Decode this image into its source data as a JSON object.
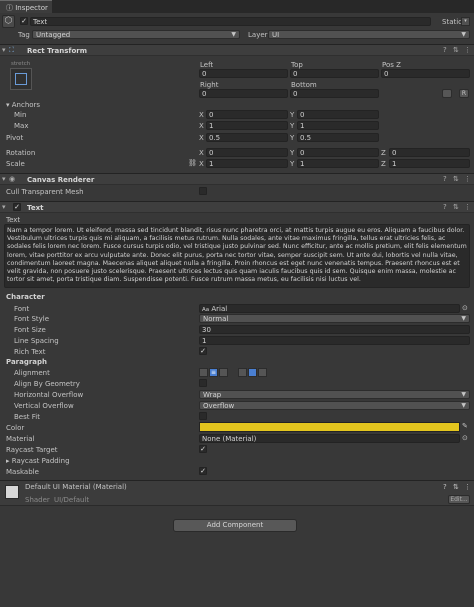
{
  "tab": {
    "label": "Inspector"
  },
  "object": {
    "name": "Text",
    "static_label": "Static",
    "tag_label": "Tag",
    "tag_value": "Untagged",
    "layer_label": "Layer",
    "layer_value": "UI"
  },
  "rect_transform": {
    "title": "Rect Transform",
    "stretch_label": "stretch",
    "left_label": "Left",
    "left_value": "0",
    "top_label": "Top",
    "top_value": "0",
    "posz_label": "Pos Z",
    "posz_value": "0",
    "right_label": "Right",
    "right_value": "0",
    "bottom_label": "Bottom",
    "bottom_value": "0",
    "anchors_label": "Anchors",
    "min_label": "Min",
    "min_x": "0",
    "min_y": "0",
    "max_label": "Max",
    "max_x": "1",
    "max_y": "1",
    "pivot_label": "Pivot",
    "pivot_x": "0.5",
    "pivot_y": "0.5",
    "rotation_label": "Rotation",
    "rot_x": "0",
    "rot_y": "0",
    "rot_z": "0",
    "scale_label": "Scale",
    "scale_x": "1",
    "scale_y": "1",
    "scale_z": "1",
    "axis_x": "X",
    "axis_y": "Y",
    "axis_z": "Z",
    "btn_r": "R"
  },
  "canvas_renderer": {
    "title": "Canvas Renderer",
    "cull_label": "Cull Transparent Mesh"
  },
  "text_component": {
    "title": "Text",
    "text_label": "Text",
    "text_value": "Nam a tempor lorem. Ut eleifend, massa sed tincidunt blandit, risus nunc pharetra orci, at mattis turpis augue eu eros. Aliquam a faucibus dolor. Vestibulum ultrices turpis quis mi aliquam, a facilisis metus rutrum. Nulla sodales, ante vitae maximus fringilla, tellus erat ultricies felis, ac sodales felis lorem nec lorem. Fusce cursus turpis odio, vel tristique justo pulvinar sed. Nunc efficitur, ante ac mollis pretium, elit felis elementum lorem, vitae porttitor ex arcu vulputate ante. Donec elit purus, porta nec tortor vitae, semper suscipit sem. Ut ante dui, lobortis vel nulla vitae, condimentum laoreet magna. Maecenas aliquet aliquet nulla a fringilla. Proin rhoncus est eget nunc venenatis tempus. Praesent rhoncus est et velit gravida, non posuere justo scelerisque. Praesent ultrices lectus quis quam iaculis faucibus quis id sem. Quisque enim massa, molestie ac tortor sit amet, porta tristique diam. Suspendisse potenti. Fusce rutrum massa metus, eu facilisis nisi luctus vel.",
    "character_label": "Character",
    "font_label": "Font",
    "font_value": "Arial",
    "font_prefix": "Aa",
    "font_style_label": "Font Style",
    "font_style_value": "Normal",
    "font_size_label": "Font Size",
    "font_size_value": "30",
    "line_spacing_label": "Line Spacing",
    "line_spacing_value": "1",
    "rich_text_label": "Rich Text",
    "paragraph_label": "Paragraph",
    "alignment_label": "Alignment",
    "align_geometry_label": "Align By Geometry",
    "h_overflow_label": "Horizontal Overflow",
    "h_overflow_value": "Wrap",
    "v_overflow_label": "Vertical Overflow",
    "v_overflow_value": "Overflow",
    "best_fit_label": "Best Fit",
    "color_label": "Color",
    "color_value": "#e3c51e",
    "material_label": "Material",
    "material_value": "None (Material)",
    "raycast_target_label": "Raycast Target",
    "raycast_padding_label": "Raycast Padding",
    "maskable_label": "Maskable"
  },
  "material_section": {
    "name": "Default UI Material (Material)",
    "shader_label": "Shader",
    "shader_value": "UI/Default",
    "edit_label": "Edit..."
  },
  "add_component": {
    "label": "Add Component"
  },
  "colors": {
    "accent_blue": "#4a7fd1",
    "text_color": "#e3c51e"
  }
}
